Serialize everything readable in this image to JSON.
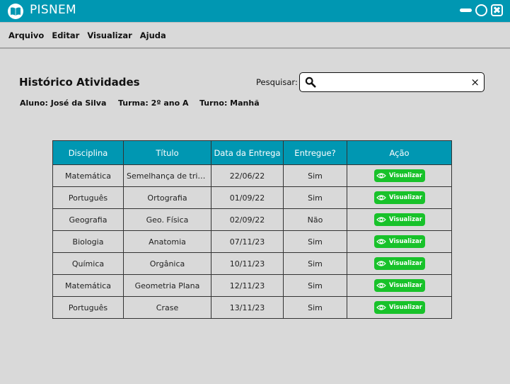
{
  "window": {
    "title": "PISNEM",
    "logo_icon": "book-icon",
    "accent_color": "#0097b2"
  },
  "menu": {
    "items": [
      "Arquivo",
      "Editar",
      "Visualizar",
      "Ajuda"
    ]
  },
  "header": {
    "title": "Histórico Atividades",
    "student": "Aluno: José da Silva",
    "class": "Turma: 2º ano A",
    "shift": "Turno: Manhã"
  },
  "search": {
    "label": "Pesquisar:",
    "value": "",
    "placeholder": "",
    "clear_label": "×"
  },
  "table": {
    "columns": [
      "Disciplina",
      "Título",
      "Data da Entrega",
      "Entregue?",
      "Ação"
    ],
    "action_label": "Visualizar",
    "action_color": "#18c22a",
    "rows": [
      {
        "subject": "Matemática",
        "title": "Semelhança de triâ...",
        "date": "22/06/22",
        "delivered": "Sim"
      },
      {
        "subject": "Português",
        "title": "Ortografia",
        "date": "01/09/22",
        "delivered": "Sim"
      },
      {
        "subject": "Geografia",
        "title": "Geo. Física",
        "date": "02/09/22",
        "delivered": "Não"
      },
      {
        "subject": "Biologia",
        "title": "Anatomia",
        "date": "07/11/23",
        "delivered": "Sim"
      },
      {
        "subject": "Química",
        "title": "Orgânica",
        "date": "10/11/23",
        "delivered": "Sim"
      },
      {
        "subject": "Matemática",
        "title": "Geometria Plana",
        "date": "12/11/23",
        "delivered": "Sim"
      },
      {
        "subject": "Português",
        "title": "Crase",
        "date": "13/11/23",
        "delivered": "Sim"
      }
    ]
  }
}
